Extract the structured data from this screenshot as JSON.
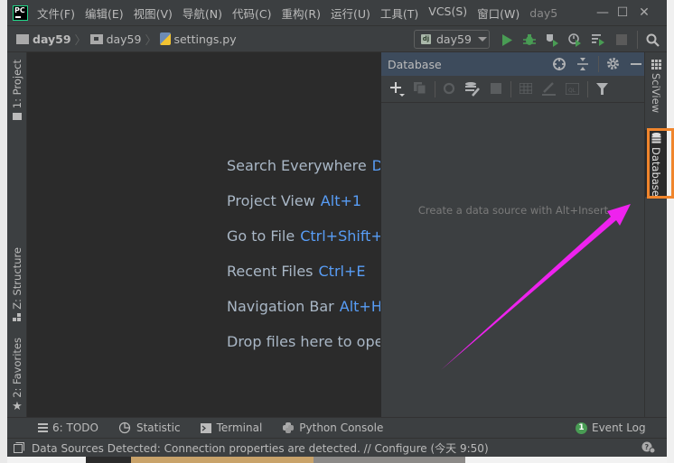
{
  "window": {
    "title": "day5",
    "controls": {
      "minimize": "—",
      "maximize": "☐",
      "close": "✕"
    }
  },
  "menu": [
    {
      "label": "文件(F)"
    },
    {
      "label": "编辑(E)"
    },
    {
      "label": "视图(V)"
    },
    {
      "label": "导航(N)"
    },
    {
      "label": "代码(C)"
    },
    {
      "label": "重构(R)"
    },
    {
      "label": "运行(U)"
    },
    {
      "label": "工具(T)"
    },
    {
      "label": "VCS(S)"
    },
    {
      "label": "窗口(W)"
    }
  ],
  "breadcrumb": [
    {
      "label": "day59"
    },
    {
      "label": "day59"
    },
    {
      "label": "settings.py"
    }
  ],
  "toolbar": {
    "run_config": "day59",
    "run_config_badge": "dj"
  },
  "left_tabs": {
    "project": "1: Project",
    "structure": "Z: Structure",
    "favorites": "2: Favorites"
  },
  "right_tabs": {
    "sciview": "SciView",
    "database": "Database"
  },
  "editor_hints": [
    {
      "label": "Search Everywhere",
      "shortcut": "Do"
    },
    {
      "label": "Project View",
      "shortcut": "Alt+1"
    },
    {
      "label": "Go to File",
      "shortcut": "Ctrl+Shift+"
    },
    {
      "label": "Recent Files",
      "shortcut": "Ctrl+E"
    },
    {
      "label": "Navigation Bar",
      "shortcut": "Alt+Ho"
    },
    {
      "label": "Drop files here to open",
      "shortcut": ""
    }
  ],
  "database_panel": {
    "title": "Database",
    "empty_text": "Create a data source with Alt+Insert"
  },
  "bottom_tabs": [
    {
      "label": "6: TODO"
    },
    {
      "label": "Statistic"
    },
    {
      "label": "Terminal"
    },
    {
      "label": "Python Console"
    }
  ],
  "event_log": {
    "label": "Event Log",
    "count": "1"
  },
  "status": {
    "message": "Data Sources Detected: Connection properties are detected. // Configure (今天 9:50)"
  },
  "colors": {
    "accent_highlight": "#f0852c",
    "annotation_arrow": "#ee22ee",
    "shortcut_blue": "#589df6",
    "run_green": "#499c54"
  }
}
